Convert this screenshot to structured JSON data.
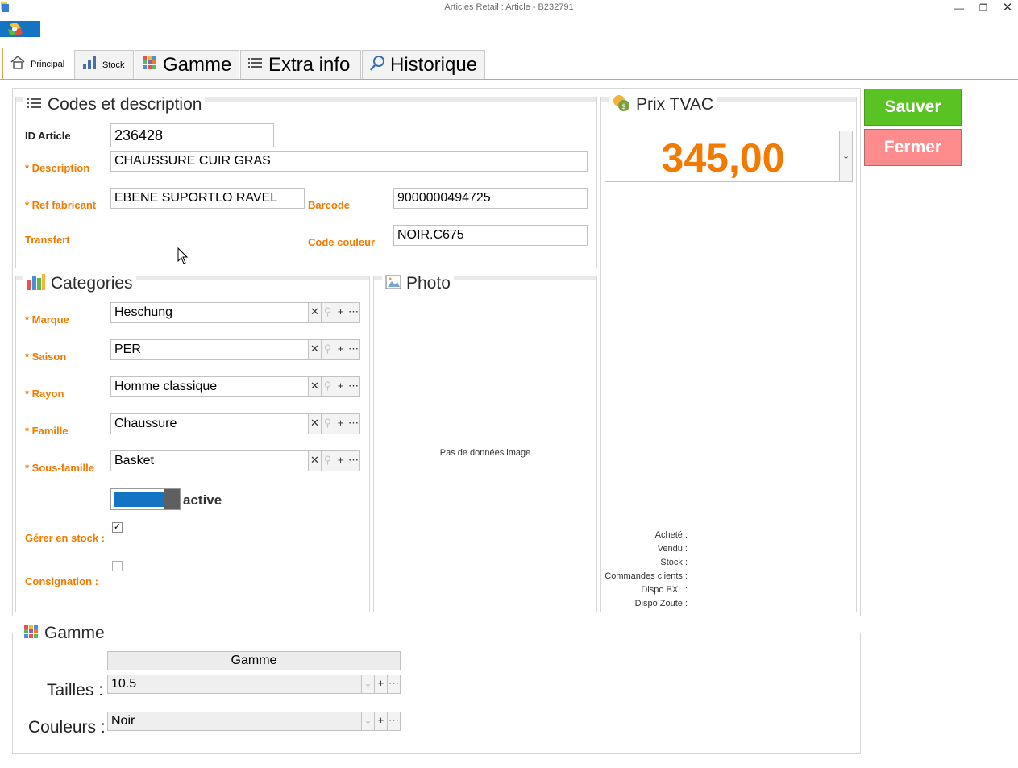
{
  "window": {
    "title": "Articles Retail : Article - B232791"
  },
  "tabs": [
    {
      "label": "Principal",
      "icon": "home-icon"
    },
    {
      "label": "Stock",
      "icon": "bar-chart-icon"
    },
    {
      "label": "Gamme",
      "icon": "grid-icon"
    },
    {
      "label": "Extra info",
      "icon": "list-icon"
    },
    {
      "label": "Historique",
      "icon": "magnifier-icon"
    }
  ],
  "codes": {
    "title": "Codes et description",
    "id_label": "ID Article",
    "id_value": "236428",
    "description_label": "* Description",
    "description_value": "CHAUSSURE CUIR GRAS",
    "ref_label": "* Ref fabricant",
    "ref_value": "EBENE SUPORTLO RAVEL",
    "barcode_label": "Barcode",
    "barcode_value": "9000000494725",
    "transfert_label": "Transfert",
    "code_couleur_label": "Code couleur",
    "code_couleur_value": "NOIR.C675"
  },
  "categories": {
    "title": "Categories",
    "marque_label": "* Marque",
    "marque_value": "Heschung",
    "saison_label": "* Saison",
    "saison_value": "PER",
    "rayon_label": "* Rayon",
    "rayon_value": "Homme classique",
    "famille_label": "* Famille",
    "famille_value": "Chaussure",
    "sous_famille_label": "* Sous-famille",
    "sous_famille_value": "Basket",
    "active_label": "active",
    "active_on": true,
    "gerer_label": "Gérer en stock :",
    "gerer_checked": true,
    "consignation_label": "Consignation :",
    "consignation_checked": false
  },
  "photo": {
    "title": "Photo",
    "empty_text": "Pas de données image"
  },
  "price": {
    "title": "Prix TVAC",
    "value": "345,00",
    "color": "#f27a00",
    "stats": [
      "Acheté :",
      "Vendu :",
      "Stock :",
      "Commandes clients :",
      "Dispo BXL :",
      "Dispo Zoute :"
    ]
  },
  "actions": {
    "save_label": "Sauver",
    "save_color": "#58c322",
    "close_label": "Fermer",
    "close_color": "#ff8c8c"
  },
  "gamme": {
    "title": "Gamme",
    "button_label": "Gamme",
    "tailles_label": "Tailles :",
    "tailles_value": "10.5",
    "couleurs_label": "Couleurs :",
    "couleurs_value": "Noir"
  }
}
